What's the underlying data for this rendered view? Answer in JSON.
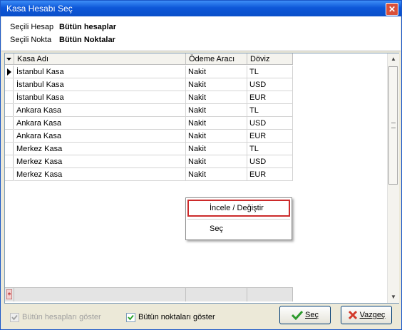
{
  "window": {
    "title": "Kasa Hesabı Seç",
    "close_glyph": "✕"
  },
  "info": {
    "selected_account_label": "Seçili Hesap",
    "selected_account_value": "Bütün hesaplar",
    "selected_point_label": "Seçili Nokta",
    "selected_point_value": "Bütün Noktalar"
  },
  "grid": {
    "columns": [
      "Kasa Adı",
      "Ödeme Aracı",
      "Döviz"
    ],
    "rows": [
      [
        "İstanbul Kasa",
        "Nakit",
        "TL"
      ],
      [
        "İstanbul Kasa",
        "Nakit",
        "USD"
      ],
      [
        "İstanbul Kasa",
        "Nakit",
        "EUR"
      ],
      [
        "Ankara Kasa",
        "Nakit",
        "TL"
      ],
      [
        "Ankara Kasa",
        "Nakit",
        "USD"
      ],
      [
        "Ankara Kasa",
        "Nakit",
        "EUR"
      ],
      [
        "Merkez Kasa",
        "Nakit",
        "TL"
      ],
      [
        "Merkez Kasa",
        "Nakit",
        "USD"
      ],
      [
        "Merkez Kasa",
        "Nakit",
        "EUR"
      ]
    ],
    "current_row_index": 0
  },
  "context_menu": {
    "items": [
      "İncele / Değiştir",
      "Seç"
    ],
    "highlighted_index": 0
  },
  "options": {
    "show_all_accounts": {
      "label": "Bütün hesapları göster",
      "checked": true,
      "enabled": false
    },
    "show_all_points": {
      "label": "Bütün noktaları göster",
      "checked": true,
      "enabled": true
    }
  },
  "buttons": {
    "select": {
      "label": "Seç",
      "icon": "check-icon"
    },
    "cancel": {
      "label": "Vazgeç",
      "icon": "cross-icon"
    }
  },
  "colors": {
    "titlebar": "#0d57d8",
    "highlight_border": "#cc2a2a",
    "select_icon": "#2c9a2c",
    "cancel_icon": "#d23a2a"
  }
}
